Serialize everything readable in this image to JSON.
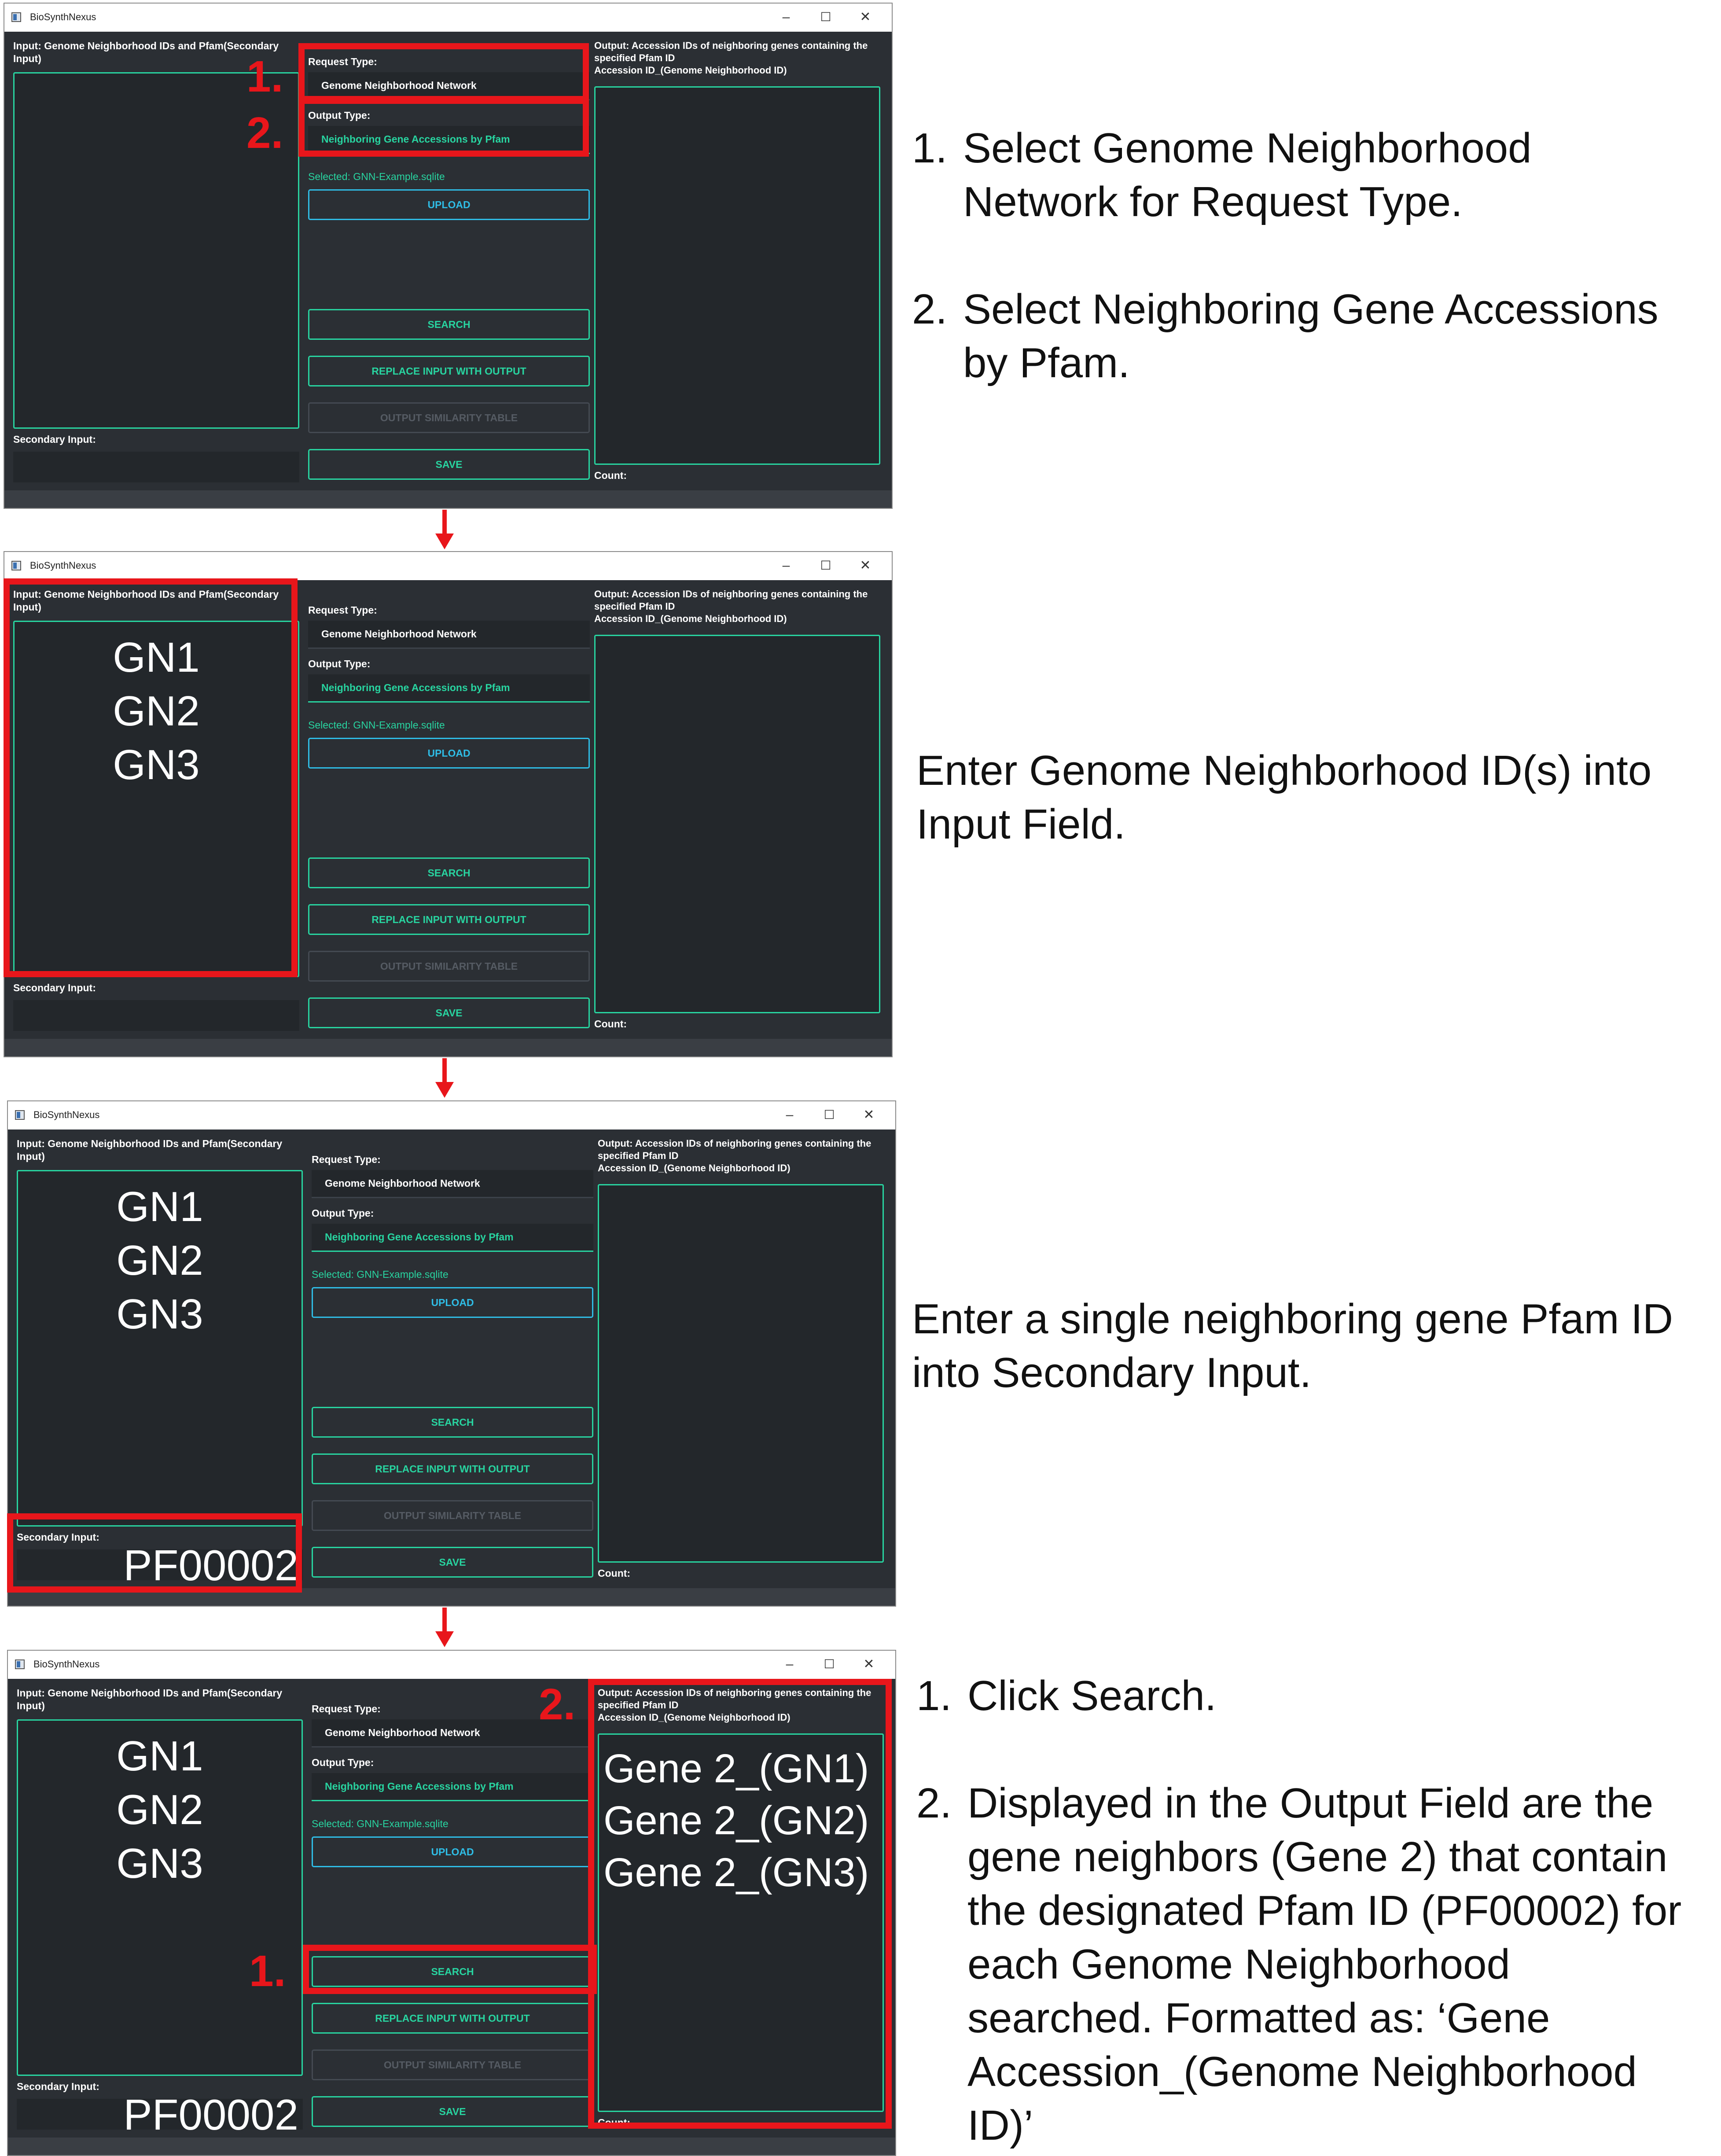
{
  "window": {
    "title": "BioSynthNexus",
    "controls": {
      "minimize": "–",
      "maximize": "☐",
      "close": "✕"
    }
  },
  "labels": {
    "input": "Input: Genome Neighborhood IDs and Pfam(Secondary Input)",
    "request_type": "Request Type:",
    "output_type": "Output Type:",
    "secondary_input": "Secondary Input:",
    "output": "Output: Accession IDs of neighboring genes containing the specified Pfam ID\nAccession ID_(Genome Neighborhood ID)",
    "count": "Count:"
  },
  "dropdowns": {
    "request_type": "Genome Neighborhood Network",
    "output_type": "Neighboring Gene Accessions by Pfam"
  },
  "selected_file": "Selected: GNN-Example.sqlite",
  "buttons": {
    "upload": "UPLOAD",
    "search": "SEARCH",
    "replace": "REPLACE INPUT WITH OUTPUT",
    "similarity": "OUTPUT SIMILARITY TABLE",
    "save": "SAVE"
  },
  "input_values": "GN1\nGN2\nGN3",
  "secondary_value": "PF00002",
  "output_values": "Gene 2_(GN1)\nGene 2_(GN2)\nGene 2_(GN3)",
  "markers": {
    "one": "1.",
    "two": "2."
  },
  "instructions": {
    "step1": {
      "item1_num": "1.",
      "item1": "Select Genome Neighborhood Network for Request Type.",
      "item2_num": "2.",
      "item2": "Select Neighboring Gene Accessions by Pfam."
    },
    "step2": "Enter Genome Neighborhood ID(s) into Input Field.",
    "step3": "Enter a single neighboring gene Pfam ID into Secondary Input.",
    "step4": {
      "item1_num": "1.",
      "item1": "Click Search.",
      "item2_num": "2.",
      "item2": "Displayed in the Output Field are the gene neighbors (Gene 2) that contain the designated Pfam ID (PF00002) for each Genome Neighborhood searched. Formatted as: ‘Gene Accession_(Genome Neighborhood ID)’"
    }
  },
  "colors": {
    "accent": "#28d4a0",
    "upload": "#2fbde6",
    "highlight": "#e8161b",
    "background": "#2b2f34"
  }
}
